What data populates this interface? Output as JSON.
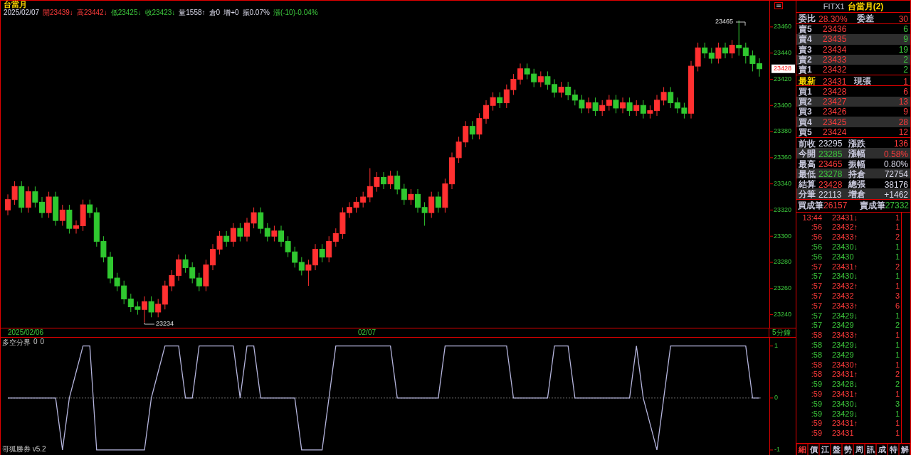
{
  "header": {
    "title": "台當月",
    "items": [
      {
        "text": "2025/02/07",
        "kind": "flat"
      },
      {
        "text": "開23439↓",
        "kind": "up"
      },
      {
        "text": "高23442↓",
        "kind": "up"
      },
      {
        "text": "低23425↓",
        "kind": "down"
      },
      {
        "text": "收23423↓",
        "kind": "down"
      },
      {
        "text": "量1558↑",
        "kind": "flat"
      },
      {
        "text": "倉0",
        "kind": "flat"
      },
      {
        "text": "增+0",
        "kind": "flat"
      },
      {
        "text": "振0.07%",
        "kind": "flat"
      },
      {
        "text": "漲(-10)-0.04%",
        "kind": "down"
      }
    ]
  },
  "price_axis": {
    "current": "23428"
  },
  "candles": {
    "high_label": "23465",
    "low_label": "23234",
    "chart_data": {
      "type": "candlestick",
      "ylim": [
        23230,
        23467
      ],
      "yticks": [
        {
          "value": 23460,
          "label": "23460"
        },
        {
          "value": 23440,
          "label": "23440"
        },
        {
          "value": 23420,
          "label": "23420"
        },
        {
          "value": 23400,
          "label": "23400"
        },
        {
          "value": 23380,
          "label": "23380"
        },
        {
          "value": 23360,
          "label": "23360"
        },
        {
          "value": 23340,
          "label": "23340"
        },
        {
          "value": 23320,
          "label": "23320"
        },
        {
          "value": 23300,
          "label": "23300"
        },
        {
          "value": 23280,
          "label": "23280"
        },
        {
          "value": 23260,
          "label": "23260"
        },
        {
          "value": 23240,
          "label": "23240"
        }
      ],
      "categories": [
        null,
        null,
        null,
        null,
        null,
        null,
        null,
        null,
        null,
        null,
        null,
        null,
        null,
        null,
        null,
        null,
        null,
        null,
        null,
        null,
        null,
        null,
        null,
        null,
        null,
        null,
        null,
        null,
        null,
        null,
        null,
        null,
        null,
        null,
        null,
        null,
        null,
        null,
        null,
        null,
        null,
        null,
        null,
        null,
        null,
        null,
        null,
        null,
        null,
        null,
        null,
        null,
        null,
        null,
        null,
        null,
        null,
        null,
        null,
        null,
        null,
        null,
        null,
        null,
        null,
        null,
        null,
        null,
        null,
        null,
        null,
        null,
        null,
        null,
        null,
        null,
        null,
        null,
        null,
        null,
        null,
        null,
        null,
        null,
        null,
        null,
        null,
        null,
        null,
        null,
        null,
        null,
        null,
        null,
        null,
        null,
        null,
        null,
        null,
        null,
        null,
        null,
        null,
        null,
        null,
        null,
        null,
        null,
        null,
        null,
        null
      ],
      "ohlc": [
        [
          23320,
          23332,
          23316,
          23328
        ],
        [
          23328,
          23342,
          23324,
          23338
        ],
        [
          23338,
          23342,
          23318,
          23322
        ],
        [
          23322,
          23338,
          23318,
          23334
        ],
        [
          23334,
          23338,
          23322,
          23326
        ],
        [
          23326,
          23330,
          23314,
          23318
        ],
        [
          23318,
          23334,
          23314,
          23330
        ],
        [
          23330,
          23334,
          23308,
          23312
        ],
        [
          23312,
          23324,
          23308,
          23320
        ],
        [
          23320,
          23324,
          23302,
          23306
        ],
        [
          23306,
          23312,
          23302,
          23308
        ],
        [
          23308,
          23328,
          23304,
          23324
        ],
        [
          23324,
          23328,
          23314,
          23318
        ],
        [
          23318,
          23322,
          23292,
          23296
        ],
        [
          23296,
          23300,
          23280,
          23284
        ],
        [
          23284,
          23288,
          23264,
          23268
        ],
        [
          23268,
          23272,
          23258,
          23262
        ],
        [
          23262,
          23266,
          23248,
          23252
        ],
        [
          23252,
          23256,
          23242,
          23246
        ],
        [
          23246,
          23250,
          23240,
          23244
        ],
        [
          23244,
          23254,
          23234,
          23250
        ],
        [
          23250,
          23254,
          23238,
          23242
        ],
        [
          23242,
          23252,
          23238,
          23248
        ],
        [
          23248,
          23266,
          23244,
          23262
        ],
        [
          23262,
          23274,
          23258,
          23270
        ],
        [
          23270,
          23286,
          23266,
          23282
        ],
        [
          23282,
          23286,
          23272,
          23276
        ],
        [
          23276,
          23280,
          23264,
          23268
        ],
        [
          23268,
          23272,
          23258,
          23262
        ],
        [
          23262,
          23282,
          23258,
          23278
        ],
        [
          23278,
          23294,
          23274,
          23290
        ],
        [
          23290,
          23304,
          23286,
          23300
        ],
        [
          23300,
          23304,
          23292,
          23296
        ],
        [
          23296,
          23310,
          23292,
          23306
        ],
        [
          23306,
          23310,
          23296,
          23300
        ],
        [
          23300,
          23314,
          23296,
          23310
        ],
        [
          23310,
          23322,
          23306,
          23318
        ],
        [
          23318,
          23322,
          23302,
          23306
        ],
        [
          23306,
          23310,
          23296,
          23300
        ],
        [
          23300,
          23308,
          23296,
          23304
        ],
        [
          23304,
          23308,
          23292,
          23296
        ],
        [
          23296,
          23300,
          23284,
          23288
        ],
        [
          23288,
          23292,
          23276,
          23280
        ],
        [
          23280,
          23284,
          23270,
          23274
        ],
        [
          23274,
          23282,
          23262,
          23278
        ],
        [
          23278,
          23294,
          23274,
          23290
        ],
        [
          23290,
          23294,
          23280,
          23284
        ],
        [
          23284,
          23300,
          23280,
          23296
        ],
        [
          23296,
          23306,
          23292,
          23302
        ],
        [
          23302,
          23322,
          23298,
          23318
        ],
        [
          23318,
          23326,
          23314,
          23322
        ],
        [
          23322,
          23330,
          23318,
          23326
        ],
        [
          23326,
          23334,
          23322,
          23330
        ],
        [
          23330,
          23352,
          23326,
          23338
        ],
        [
          23338,
          23349,
          23334,
          23345
        ],
        [
          23345,
          23349,
          23336,
          23340
        ],
        [
          23340,
          23350,
          23336,
          23346
        ],
        [
          23346,
          23350,
          23332,
          23336
        ],
        [
          23336,
          23340,
          23324,
          23328
        ],
        [
          23328,
          23336,
          23324,
          23332
        ],
        [
          23332,
          23336,
          23318,
          23322
        ],
        [
          23322,
          23326,
          23308,
          23318
        ],
        [
          23318,
          23334,
          23314,
          23330
        ],
        [
          23330,
          23334,
          23318,
          23322
        ],
        [
          23322,
          23344,
          23318,
          23340
        ],
        [
          23340,
          23364,
          23336,
          23360
        ],
        [
          23360,
          23376,
          23356,
          23372
        ],
        [
          23372,
          23388,
          23368,
          23384
        ],
        [
          23384,
          23388,
          23374,
          23378
        ],
        [
          23378,
          23394,
          23374,
          23390
        ],
        [
          23390,
          23404,
          23386,
          23400
        ],
        [
          23400,
          23410,
          23396,
          23406
        ],
        [
          23406,
          23410,
          23398,
          23402
        ],
        [
          23402,
          23416,
          23398,
          23412
        ],
        [
          23412,
          23424,
          23408,
          23420
        ],
        [
          23420,
          23432,
          23416,
          23428
        ],
        [
          23428,
          23432,
          23420,
          23424
        ],
        [
          23424,
          23428,
          23414,
          23418
        ],
        [
          23418,
          23426,
          23414,
          23422
        ],
        [
          23422,
          23426,
          23412,
          23416
        ],
        [
          23416,
          23420,
          23406,
          23410
        ],
        [
          23410,
          23418,
          23406,
          23414
        ],
        [
          23414,
          23418,
          23404,
          23408
        ],
        [
          23408,
          23412,
          23400,
          23404
        ],
        [
          23404,
          23408,
          23394,
          23398
        ],
        [
          23398,
          23406,
          23394,
          23402
        ],
        [
          23402,
          23406,
          23392,
          23396
        ],
        [
          23396,
          23404,
          23392,
          23400
        ],
        [
          23400,
          23408,
          23396,
          23404
        ],
        [
          23404,
          23408,
          23394,
          23398
        ],
        [
          23398,
          23406,
          23394,
          23402
        ],
        [
          23402,
          23406,
          23392,
          23396
        ],
        [
          23396,
          23404,
          23392,
          23400
        ],
        [
          23400,
          23404,
          23390,
          23394
        ],
        [
          23394,
          23400,
          23390,
          23396
        ],
        [
          23396,
          23408,
          23392,
          23404
        ],
        [
          23404,
          23414,
          23400,
          23410
        ],
        [
          23410,
          23414,
          23398,
          23402
        ],
        [
          23402,
          23406,
          23394,
          23398
        ],
        [
          23398,
          23402,
          23390,
          23394
        ],
        [
          23394,
          23434,
          23390,
          23430
        ],
        [
          23430,
          23448,
          23426,
          23444
        ],
        [
          23444,
          23448,
          23436,
          23440
        ],
        [
          23440,
          23444,
          23432,
          23436
        ],
        [
          23436,
          23448,
          23432,
          23444
        ],
        [
          23444,
          23448,
          23436,
          23440
        ],
        [
          23440,
          23450,
          23436,
          23446
        ],
        [
          23446,
          23465,
          23438,
          23444
        ],
        [
          23444,
          23448,
          23432,
          23438
        ],
        [
          23438,
          23442,
          23426,
          23432
        ],
        [
          23432,
          23436,
          23422,
          23428
        ]
      ]
    }
  },
  "time_strip": {
    "start": "2025/02/06",
    "mid": "02/07",
    "interval": "5分鐘"
  },
  "indicator": {
    "values": [
      "0",
      "0"
    ],
    "brand": "哥狐勝券 v5.2",
    "chart_data": {
      "type": "line",
      "ylim": [
        -1.11,
        1.16
      ],
      "yticks": [
        {
          "value": 1,
          "label": "1"
        },
        {
          "value": 0,
          "label": "0"
        },
        {
          "value": -1,
          "label": "-1"
        }
      ],
      "categories": [
        null,
        null,
        null,
        null,
        null,
        null,
        null,
        null,
        null,
        null,
        null,
        null,
        null,
        null,
        null,
        null,
        null,
        null,
        null,
        null,
        null,
        null,
        null,
        null,
        null,
        null,
        null,
        null,
        null,
        null,
        null,
        null,
        null,
        null,
        null,
        null,
        null,
        null,
        null,
        null,
        null,
        null,
        null,
        null,
        null,
        null,
        null,
        null,
        null,
        null,
        null,
        null,
        null,
        null,
        null,
        null,
        null,
        null,
        null,
        null,
        null,
        null,
        null,
        null,
        null,
        null,
        null,
        null,
        null,
        null,
        null,
        null,
        null,
        null,
        null,
        null,
        null,
        null,
        null,
        null,
        null,
        null,
        null,
        null,
        null,
        null,
        null,
        null,
        null,
        null,
        null,
        null,
        null,
        null,
        null,
        null,
        null,
        null,
        null,
        null,
        null,
        null,
        null,
        null,
        null,
        null,
        null,
        null,
        null,
        null,
        null
      ],
      "series": [
        {
          "name": "多空分界",
          "color": "#b4b4dc",
          "values": [
            0,
            0,
            0,
            0,
            0,
            0,
            0,
            0,
            -1,
            0,
            0.5,
            1,
            1,
            -1,
            -1,
            -1,
            -1,
            -1,
            -1,
            -1,
            -1,
            0,
            0.5,
            1,
            1,
            1,
            0,
            0,
            1,
            1,
            1,
            1,
            1,
            1,
            0,
            1,
            1,
            0,
            0,
            0,
            0,
            0,
            0,
            -1,
            -1,
            -1,
            -1,
            0,
            1,
            1,
            1,
            1,
            1,
            1,
            1,
            1,
            1,
            0,
            0,
            0,
            0,
            0,
            0,
            0,
            1,
            1,
            1,
            1,
            1,
            1,
            1,
            1,
            1,
            1,
            0,
            0,
            0,
            0,
            0,
            0,
            1,
            1,
            1,
            0,
            0,
            0,
            0,
            0,
            0,
            0,
            0,
            0,
            1,
            0,
            -0.5,
            -1,
            0,
            1,
            1,
            1,
            1,
            1,
            1,
            1,
            1,
            1,
            1,
            1,
            1,
            0,
            0
          ]
        }
      ]
    }
  },
  "quote": {
    "symbol": "FITX1",
    "name": "台當月(2)",
    "ratio": {
      "label": "委比",
      "value": "28.30%",
      "label2": "委差",
      "value2": "30"
    },
    "asks": [
      {
        "label": "賣5",
        "price": "23436",
        "qty": "6"
      },
      {
        "label": "賣4",
        "price": "23435",
        "qty": "9"
      },
      {
        "label": "賣3",
        "price": "23434",
        "qty": "19"
      },
      {
        "label": "賣2",
        "price": "23433",
        "qty": "2"
      },
      {
        "label": "賣1",
        "price": "23432",
        "qty": "2"
      }
    ],
    "last": {
      "label": "最新",
      "price": "23431",
      "label2": "現張",
      "qty": "1"
    },
    "bids": [
      {
        "label": "買1",
        "price": "23428",
        "qty": "6"
      },
      {
        "label": "買2",
        "price": "23427",
        "qty": "13"
      },
      {
        "label": "買3",
        "price": "23426",
        "qty": "9"
      },
      {
        "label": "買4",
        "price": "23425",
        "qty": "28"
      },
      {
        "label": "買5",
        "price": "23424",
        "qty": "12"
      }
    ],
    "stats": [
      {
        "label": "前收",
        "value": "23295",
        "kind": "flat"
      },
      {
        "label": "漲跌",
        "value": "136",
        "kind": "up"
      },
      {
        "label": "今開",
        "value": "23285",
        "kind": "down"
      },
      {
        "label": "漲幅",
        "value": "0.58%",
        "kind": "up"
      },
      {
        "label": "最高",
        "value": "23465",
        "kind": "up"
      },
      {
        "label": "振幅",
        "value": "0.80%",
        "kind": "flat"
      },
      {
        "label": "最低",
        "value": "23278",
        "kind": "down"
      },
      {
        "label": "持倉",
        "value": "72754",
        "kind": "flat"
      },
      {
        "label": "結算",
        "value": "23428",
        "kind": "up"
      },
      {
        "label": "總張",
        "value": "38176",
        "kind": "flat"
      },
      {
        "label": "分筆",
        "value": "22113",
        "kind": "flat"
      },
      {
        "label": "增倉",
        "value": "+1462",
        "kind": "flat"
      }
    ],
    "trades": [
      {
        "label": "買成筆",
        "value": "26157",
        "kind": "up"
      },
      {
        "label": "賣成筆",
        "value": "27332",
        "kind": "down"
      }
    ],
    "ticks": [
      {
        "time": "13:44",
        "price": "23431↓",
        "qty": "1",
        "kind": "up"
      },
      {
        "time": ":56",
        "price": "23432↑",
        "qty": "1",
        "kind": "up"
      },
      {
        "time": ":56",
        "price": "23433↑",
        "qty": "2",
        "kind": "up"
      },
      {
        "time": ":56",
        "price": "23430↓",
        "qty": "1",
        "kind": "down"
      },
      {
        "time": ":56",
        "price": "23430",
        "qty": "1",
        "kind": "down"
      },
      {
        "time": ":57",
        "price": "23431↑",
        "qty": "2",
        "kind": "up"
      },
      {
        "time": ":57",
        "price": "23430↓",
        "qty": "1",
        "kind": "down"
      },
      {
        "time": ":57",
        "price": "23432↑",
        "qty": "1",
        "kind": "up"
      },
      {
        "time": ":57",
        "price": "23432",
        "qty": "3",
        "kind": "up"
      },
      {
        "time": ":57",
        "price": "23433↑",
        "qty": "6",
        "kind": "up"
      },
      {
        "time": ":57",
        "price": "23429↓",
        "qty": "1",
        "kind": "down"
      },
      {
        "time": ":57",
        "price": "23429",
        "qty": "2",
        "kind": "down"
      },
      {
        "time": ":58",
        "price": "23433↑",
        "qty": "1",
        "kind": "up"
      },
      {
        "time": ":58",
        "price": "23429↓",
        "qty": "1",
        "kind": "down"
      },
      {
        "time": ":58",
        "price": "23429",
        "qty": "1",
        "kind": "down"
      },
      {
        "time": ":58",
        "price": "23430↑",
        "qty": "1",
        "kind": "up"
      },
      {
        "time": ":58",
        "price": "23431↑",
        "qty": "2",
        "kind": "up"
      },
      {
        "time": ":59",
        "price": "23428↓",
        "qty": "2",
        "kind": "down"
      },
      {
        "time": ":59",
        "price": "23431↑",
        "qty": "1",
        "kind": "up"
      },
      {
        "time": ":59",
        "price": "23430↓",
        "qty": "3",
        "kind": "down"
      },
      {
        "time": ":59",
        "price": "23429↓",
        "qty": "1",
        "kind": "down"
      },
      {
        "time": ":59",
        "price": "23431↑",
        "qty": "1",
        "kind": "up"
      },
      {
        "time": ":59",
        "price": "23431",
        "qty": "1",
        "kind": "up"
      }
    ],
    "tabs": [
      {
        "label": "細",
        "selected": true
      },
      {
        "label": "價",
        "selected": false
      },
      {
        "label": "江",
        "selected": false
      },
      {
        "label": "盤",
        "selected": false
      },
      {
        "label": "勢",
        "selected": false
      },
      {
        "label": "周",
        "selected": false
      },
      {
        "label": "訊",
        "selected": false
      },
      {
        "label": "成",
        "selected": false
      },
      {
        "label": "特",
        "selected": false
      },
      {
        "label": "解",
        "selected": false
      }
    ]
  }
}
